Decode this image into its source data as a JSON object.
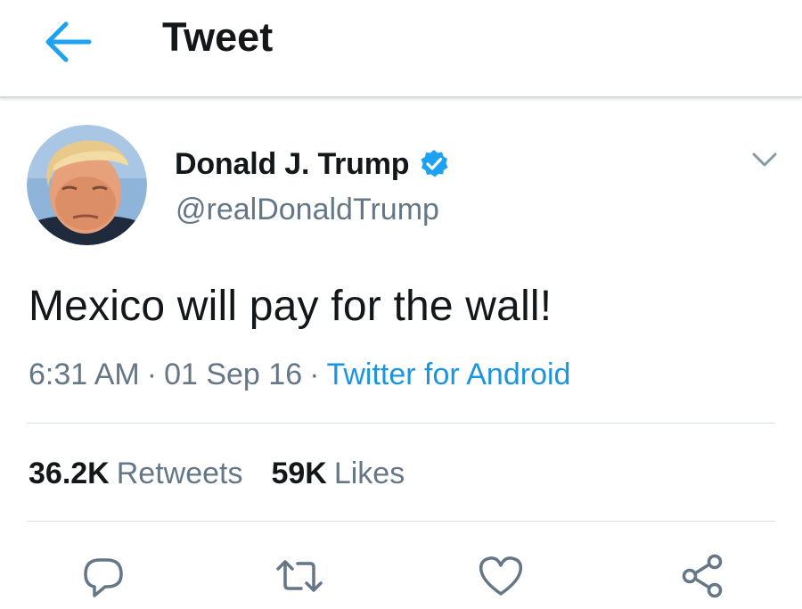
{
  "header": {
    "title": "Tweet",
    "back_icon": "arrow-left-icon"
  },
  "author": {
    "name": "Donald J. Trump",
    "handle": "@realDonaldTrump",
    "verified_icon": "verified-badge-icon",
    "avatar_icon": "avatar"
  },
  "tweet": {
    "text": "Mexico will pay for the wall!",
    "time": "6:31 AM",
    "date": "01 Sep 16",
    "source": "Twitter for Android",
    "separator": "·"
  },
  "stats": {
    "retweets_count": "36.2K",
    "retweets_label": "Retweets",
    "likes_count": "59K",
    "likes_label": "Likes"
  },
  "actions": [
    {
      "icon": "reply-icon"
    },
    {
      "icon": "retweet-icon"
    },
    {
      "icon": "like-heart-icon"
    },
    {
      "icon": "share-icon"
    }
  ],
  "colors": {
    "accent": "#1b95e0",
    "secondary_text": "#657786",
    "primary_text": "#14171a",
    "divider": "#d8dfe5",
    "verified": "#1da1f2"
  }
}
